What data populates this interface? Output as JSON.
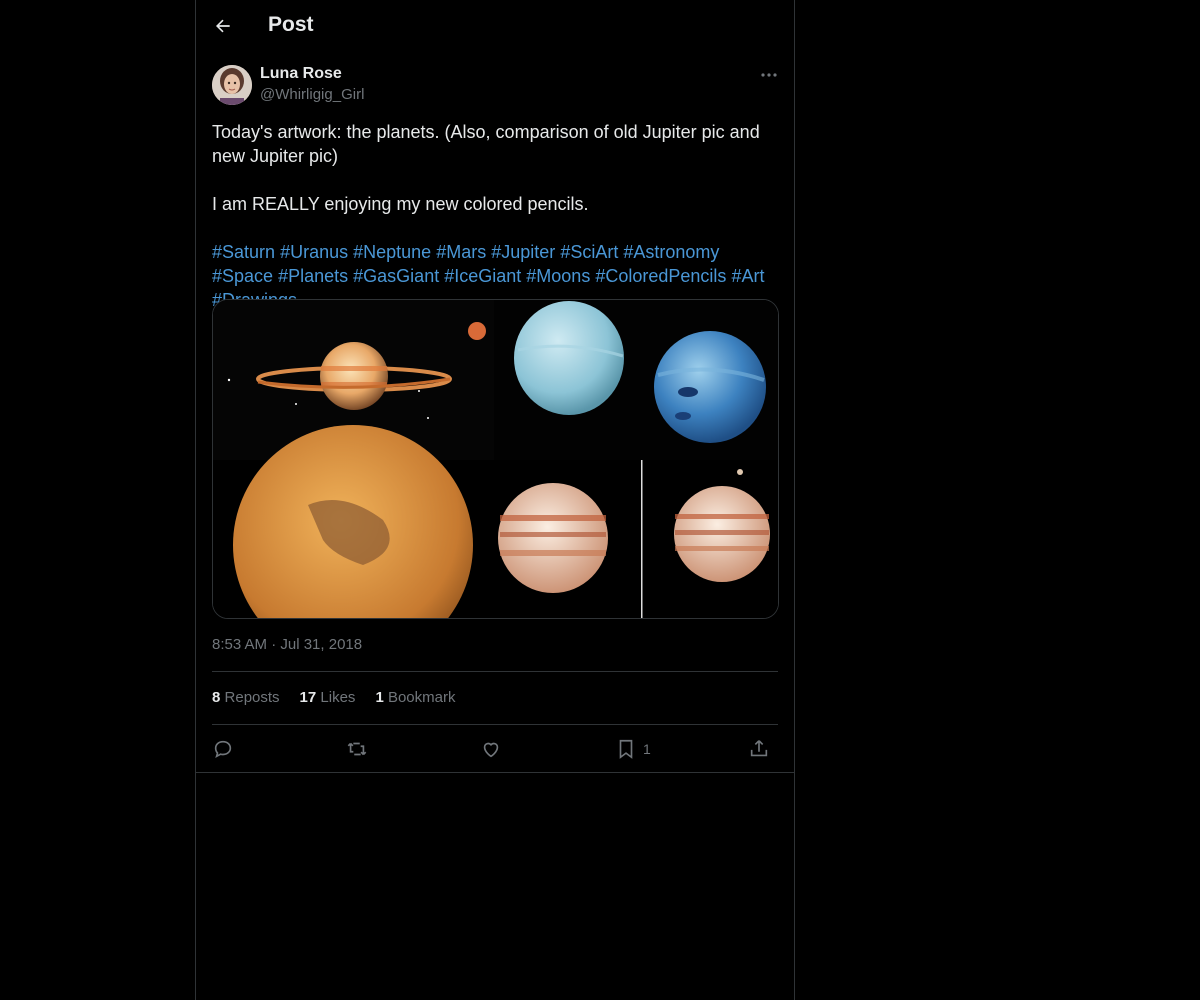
{
  "header": {
    "title": "Post",
    "back_icon": "arrow-left-icon"
  },
  "author": {
    "name": "Luna Rose",
    "handle": "@Whirligig_Girl"
  },
  "post": {
    "line1": "Today's artwork: the planets. (Also, comparison of old Jupiter pic and new Jupiter pic)",
    "line2": "I am REALLY enjoying my new colored pencils.",
    "hashtags": [
      "#Saturn",
      "#Uranus",
      "#Neptune",
      "#Mars",
      "#Jupiter",
      "#SciArt",
      "#Astronomy",
      "#Space",
      "#Planets",
      "#GasGiant",
      "#IceGiant",
      "#Moons",
      "#ColoredPencils",
      "#Art",
      "#Drawings"
    ],
    "timestamp": "8:53 AM · Jul 31, 2018"
  },
  "stats": {
    "reposts_count": "8",
    "reposts_label": "Reposts",
    "likes_count": "17",
    "likes_label": "Likes",
    "bookmarks_count": "1",
    "bookmarks_label": "Bookmark"
  },
  "actions": {
    "bookmark_count": "1"
  },
  "colors": {
    "background": "#000000",
    "text": "#e7e9ea",
    "muted": "#71767b",
    "link": "#4a97d6",
    "border": "#2f3336"
  }
}
